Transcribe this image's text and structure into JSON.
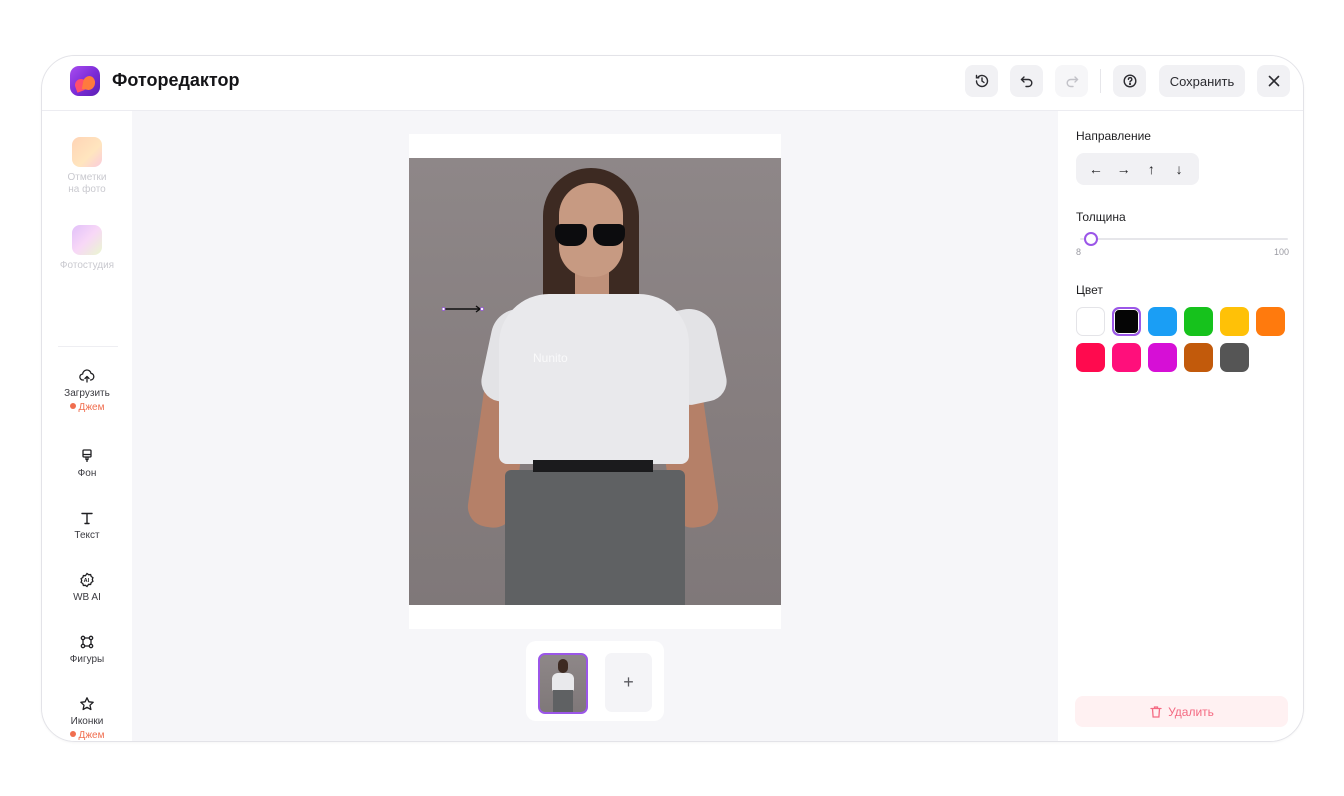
{
  "app": {
    "title": "Фоторедактор"
  },
  "header": {
    "history_icon": "history-icon",
    "undo_icon": "undo-icon",
    "redo_icon": "redo-icon",
    "help_icon": "help-icon",
    "save_label": "Сохранить",
    "close_icon": "close-icon"
  },
  "sidebar": {
    "items": [
      {
        "label_line1": "Отметки",
        "label_line2": "на фото",
        "icon": "tags-thumbnail",
        "disabled": true
      },
      {
        "label": "Фотостудия",
        "icon": "studio-thumbnail",
        "disabled": true
      },
      {
        "label": "Загрузить",
        "icon": "upload-cloud-icon",
        "badge": "Джем"
      },
      {
        "label": "Фон",
        "icon": "brush-icon"
      },
      {
        "label": "Текст",
        "icon": "text-icon"
      },
      {
        "label": "WB AI",
        "icon": "ai-icon"
      },
      {
        "label": "Фигуры",
        "icon": "shapes-icon"
      },
      {
        "label": "Иконки",
        "icon": "star-icon",
        "badge": "Джем"
      }
    ]
  },
  "canvas": {
    "text_layer": "Nunito",
    "add_page_label": "+"
  },
  "panel": {
    "direction_label": "Направление",
    "directions": [
      "←",
      "→",
      "↑",
      "↓"
    ],
    "thickness_label": "Толщина",
    "thickness_min": "8",
    "thickness_max": "100",
    "thickness_value": 8,
    "color_label": "Цвет",
    "colors": [
      "#ffffff",
      "#050505",
      "#1a9ef5",
      "#16c21c",
      "#ffc107",
      "#ff7a0d",
      "#ff0a4e",
      "#ff0f7b",
      "#d60fd6",
      "#c25a0b",
      "#555555"
    ],
    "selected_color": "#050505",
    "delete_label": "Удалить"
  }
}
